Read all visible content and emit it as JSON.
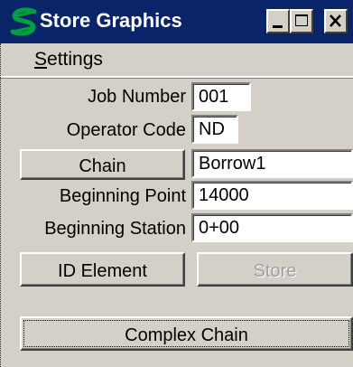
{
  "window": {
    "title": "Store Graphics",
    "app_icon": "microstation-s-icon",
    "controls": [
      "minimize-icon",
      "maximize-icon",
      "close-icon"
    ]
  },
  "menubar": {
    "settings_prefix": "S",
    "settings_rest": "ettings"
  },
  "form": {
    "job_number_label": "Job Number",
    "job_number_value": "001",
    "operator_code_label": "Operator Code",
    "operator_code_value": "ND",
    "chain_button": "Chain",
    "chain_value": "Borrow1",
    "beginning_point_label": "Beginning Point",
    "beginning_point_value": "14000",
    "beginning_station_label": "Beginning Station",
    "beginning_station_value": "0+00"
  },
  "buttons": {
    "id_element": "ID Element",
    "store": "Store",
    "store_enabled": false,
    "complex_chain": "Complex Chain"
  },
  "colors": {
    "titlebar": "#0a246a",
    "face": "#d4d0c8",
    "icon_green": "#00a040"
  }
}
